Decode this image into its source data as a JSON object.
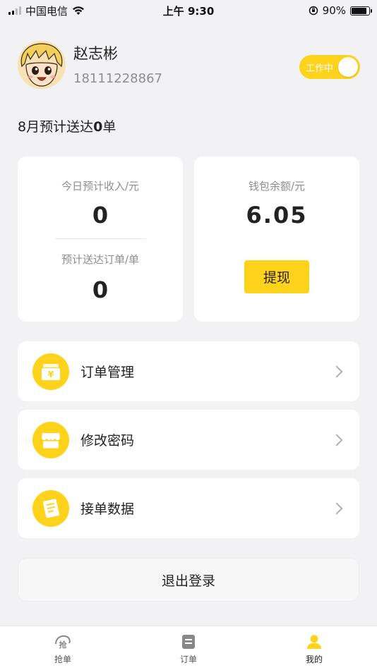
{
  "status_bar": {
    "carrier": "中国电信",
    "time": "上午 9:30",
    "battery": "90%"
  },
  "profile": {
    "name": "赵志彬",
    "phone": "18111228867",
    "work_status": "工作中"
  },
  "monthly": {
    "prefix": "8月预计送达",
    "count": "0",
    "suffix": "单"
  },
  "stats": {
    "today_income_label": "今日预计收入/元",
    "today_income_value": "0",
    "expected_orders_label": "预计送达订单/单",
    "expected_orders_value": "0",
    "wallet_label": "钱包余额/元",
    "wallet_value": "6.05",
    "withdraw_label": "提现"
  },
  "menu": [
    {
      "label": "订单管理",
      "icon": "order-management-icon"
    },
    {
      "label": "修改密码",
      "icon": "store-icon"
    },
    {
      "label": "接单数据",
      "icon": "document-list-icon"
    }
  ],
  "logout_label": "退出登录",
  "tabs": [
    {
      "label": "抢单",
      "icon": "grab-order-icon"
    },
    {
      "label": "订单",
      "icon": "orders-icon"
    },
    {
      "label": "我的",
      "icon": "person-icon"
    }
  ],
  "colors": {
    "accent": "#ffd21c",
    "background": "#f2f2f4"
  }
}
